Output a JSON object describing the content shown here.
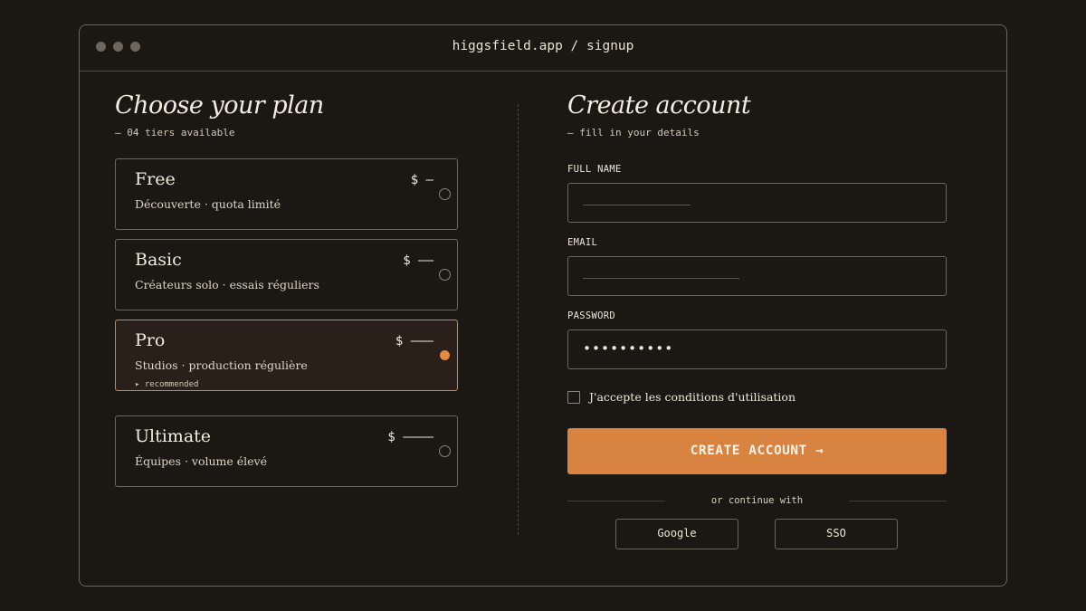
{
  "browser": {
    "url": "higgsfield.app / signup"
  },
  "plans_section": {
    "heading": "Choose your plan",
    "subheading": "— 04 tiers available",
    "plans": [
      {
        "name": "Free",
        "description": "Découverte · quota limité",
        "price": "$ —",
        "selected": false
      },
      {
        "name": "Basic",
        "description": "Créateurs solo · essais réguliers",
        "price": "$ ——",
        "selected": false
      },
      {
        "name": "Pro",
        "description": "Studios · production régulière",
        "price": "$ ———",
        "selected": true,
        "tag": "▸ recommended"
      },
      {
        "name": "Ultimate",
        "description": "Équipes · volume élevé",
        "price": "$ ————",
        "selected": false
      }
    ]
  },
  "account_section": {
    "heading": "Create account",
    "subheading": "— fill in your details",
    "fields": {
      "full_name": {
        "label": "FULL NAME",
        "value": ""
      },
      "email": {
        "label": "EMAIL",
        "value": ""
      },
      "password": {
        "label": "PASSWORD",
        "value": "••••••••••"
      }
    },
    "terms_label": "J'accepte les conditions d'utilisation",
    "terms_checked": false,
    "submit_label": "CREATE ACCOUNT →",
    "divider_text": "or continue with",
    "alt_logins": [
      "Google",
      "SSO"
    ]
  },
  "colors": {
    "background": "#1b1814",
    "accent": "#d98340",
    "selected_card_bg": "#2b2019",
    "border": "#6a655d"
  }
}
